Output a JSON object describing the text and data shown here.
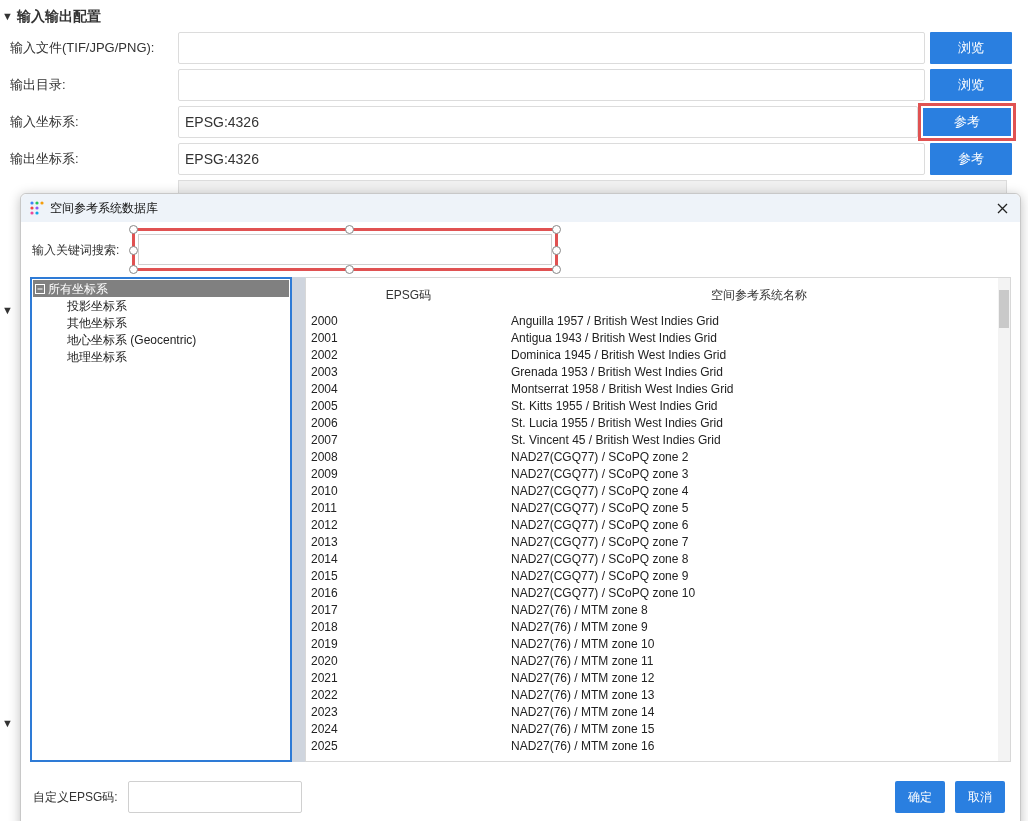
{
  "section": {
    "title": "输入输出配置",
    "expanded": true
  },
  "form_rows": [
    {
      "label": "输入文件(TIF/JPG/PNG):",
      "button": "浏览",
      "highlighted": false
    },
    {
      "label": "输出目录:",
      "button": "浏览",
      "highlighted": false
    },
    {
      "label": "输入坐标系:",
      "value": "EPSG:4326",
      "button": "参考",
      "highlighted": true
    },
    {
      "label": "输出坐标系:",
      "value": "EPSG:4326",
      "button": "参考",
      "highlighted": false
    }
  ],
  "covered_sections": [
    {
      "marker": "▼"
    },
    {
      "marker": "▼"
    }
  ],
  "dialog": {
    "title": "空间参考系统数据库",
    "search": {
      "label": "输入关键词搜索:",
      "selected": true
    },
    "tree": {
      "label": "所有坐标系",
      "expanded": true,
      "selected": true,
      "children": [
        {
          "label": "投影坐标系"
        },
        {
          "label": "其他坐标系"
        },
        {
          "label": "地心坐标系 (Geocentric)"
        },
        {
          "label": "地理坐标系"
        }
      ]
    },
    "table": {
      "columns": [
        "EPSG码",
        "空间参考系统名称"
      ],
      "rows": [
        {
          "code": "2000",
          "name": "Anguilla 1957 / British West Indies Grid"
        },
        {
          "code": "2001",
          "name": "Antigua 1943 / British West Indies Grid"
        },
        {
          "code": "2002",
          "name": "Dominica 1945 / British West Indies Grid"
        },
        {
          "code": "2003",
          "name": "Grenada 1953 / British West Indies Grid"
        },
        {
          "code": "2004",
          "name": "Montserrat 1958 / British West Indies Grid"
        },
        {
          "code": "2005",
          "name": "St. Kitts 1955 / British West Indies Grid"
        },
        {
          "code": "2006",
          "name": "St. Lucia 1955 / British West Indies Grid"
        },
        {
          "code": "2007",
          "name": "St. Vincent 45 / British West Indies Grid"
        },
        {
          "code": "2008",
          "name": "NAD27(CGQ77) / SCoPQ zone 2"
        },
        {
          "code": "2009",
          "name": "NAD27(CGQ77) / SCoPQ zone 3"
        },
        {
          "code": "2010",
          "name": "NAD27(CGQ77) / SCoPQ zone 4"
        },
        {
          "code": "2011",
          "name": "NAD27(CGQ77) / SCoPQ zone 5"
        },
        {
          "code": "2012",
          "name": "NAD27(CGQ77) / SCoPQ zone 6"
        },
        {
          "code": "2013",
          "name": "NAD27(CGQ77) / SCoPQ zone 7"
        },
        {
          "code": "2014",
          "name": "NAD27(CGQ77) / SCoPQ zone 8"
        },
        {
          "code": "2015",
          "name": "NAD27(CGQ77) / SCoPQ zone 9"
        },
        {
          "code": "2016",
          "name": "NAD27(CGQ77) / SCoPQ zone 10"
        },
        {
          "code": "2017",
          "name": "NAD27(76) / MTM zone 8"
        },
        {
          "code": "2018",
          "name": "NAD27(76) / MTM zone 9"
        },
        {
          "code": "2019",
          "name": "NAD27(76) / MTM zone 10"
        },
        {
          "code": "2020",
          "name": "NAD27(76) / MTM zone 11"
        },
        {
          "code": "2021",
          "name": "NAD27(76) / MTM zone 12"
        },
        {
          "code": "2022",
          "name": "NAD27(76) / MTM zone 13"
        },
        {
          "code": "2023",
          "name": "NAD27(76) / MTM zone 14"
        },
        {
          "code": "2024",
          "name": "NAD27(76) / MTM zone 15"
        },
        {
          "code": "2025",
          "name": "NAD27(76) / MTM zone 16"
        }
      ]
    },
    "custom_epsg": {
      "label": "自定义EPSG码:"
    },
    "buttons": [
      "确定",
      "取消"
    ]
  }
}
